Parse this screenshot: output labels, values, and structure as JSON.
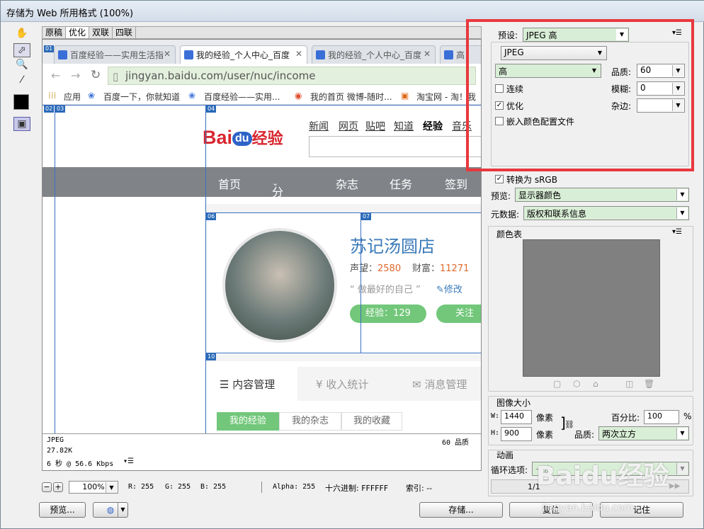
{
  "window": {
    "title": "存储为 Web 所用格式 (100%)"
  },
  "view_tabs": [
    "原稿",
    "优化",
    "双联",
    "四联"
  ],
  "browser": {
    "tabs": [
      "百度经验——实用生活指",
      "我的经验_个人中心_百度",
      "我的经验_个人中心_百度",
      "高"
    ],
    "url": "jingyan.baidu.com/user/nuc/income",
    "bookmarks": [
      "应用",
      "百度一下，你就知道",
      "百度经验——实用...",
      "我的首页 微博-随时...",
      "淘宝网 - 淘！我"
    ]
  },
  "slices": [
    "01",
    "02",
    "03",
    "04",
    "06",
    "07",
    "10"
  ],
  "page": {
    "logo": "Bai",
    "logo_du": "du",
    "logo_suffix": "经验",
    "top_links": [
      "新闻",
      "网页",
      "贴吧",
      "知道",
      "经验",
      "音乐"
    ],
    "nav": [
      "首页",
      "分类",
      "杂志",
      "任务",
      "签到"
    ],
    "nav_arrow": "⌄",
    "user_name": "苏记汤圆店",
    "prestige_label": "声望：",
    "prestige_value": "2580",
    "wealth_label": "财富：",
    "wealth_value": "11271",
    "motto": "做最好的自己",
    "edit_label": "修改",
    "exp_btn": "经验：129",
    "follow_btn": "关注",
    "section_tabs": [
      "内容管理",
      "收入统计",
      "消息管理"
    ],
    "sub_tabs": [
      "我的经验",
      "我的杂志",
      "我的收藏"
    ]
  },
  "status": {
    "format": "JPEG",
    "size": "27.82K",
    "speed": "6 秒 @ 56.6 Kbps",
    "quality": "60 品质"
  },
  "bottom": {
    "zoom": "100%",
    "r": "R: 255",
    "g": "G: 255",
    "b": "B: 255",
    "alpha": "Alpha: 255",
    "hex": "十六进制: FFFFFF",
    "index": "索引: --",
    "preview_btn": "预览...",
    "save_btn": "存储...",
    "reset_btn": "复位",
    "remember_btn": "记住"
  },
  "settings": {
    "preset_label": "预设:",
    "preset_value": "JPEG 高",
    "format_value": "JPEG",
    "quality_level": "高",
    "quality_label": "品质:",
    "quality_value": "60",
    "progressive_label": "连续",
    "blur_label": "模糊:",
    "blur_value": "0",
    "optimized_label": "优化",
    "matte_label": "杂边:",
    "embed_profile_label": "嵌入颜色配置文件",
    "convert_srgb_label": "转换为 sRGB",
    "preview_label": "预览:",
    "preview_value": "显示器颜色",
    "metadata_label": "元数据:",
    "metadata_value": "版权和联系信息",
    "color_table_label": "颜色表",
    "image_size_label": "图像大小",
    "w_label": "W:",
    "w_value": "1440",
    "h_label": "H:",
    "h_value": "900",
    "px_label": "像素",
    "percent_label": "百分比:",
    "percent_value": "100",
    "percent_unit": "%",
    "resample_label": "品质:",
    "resample_value": "两次立方",
    "animation_label": "动画",
    "loop_label": "循环选项:",
    "loop_value": "一次",
    "frame_counter": "1/1"
  },
  "watermark": {
    "text": "Baidu经验",
    "url": "jingyan.baidu.com"
  },
  "colors": {
    "highlight": "#e8383d",
    "accent_green": "#72c77a",
    "orange": "#e0692c"
  }
}
